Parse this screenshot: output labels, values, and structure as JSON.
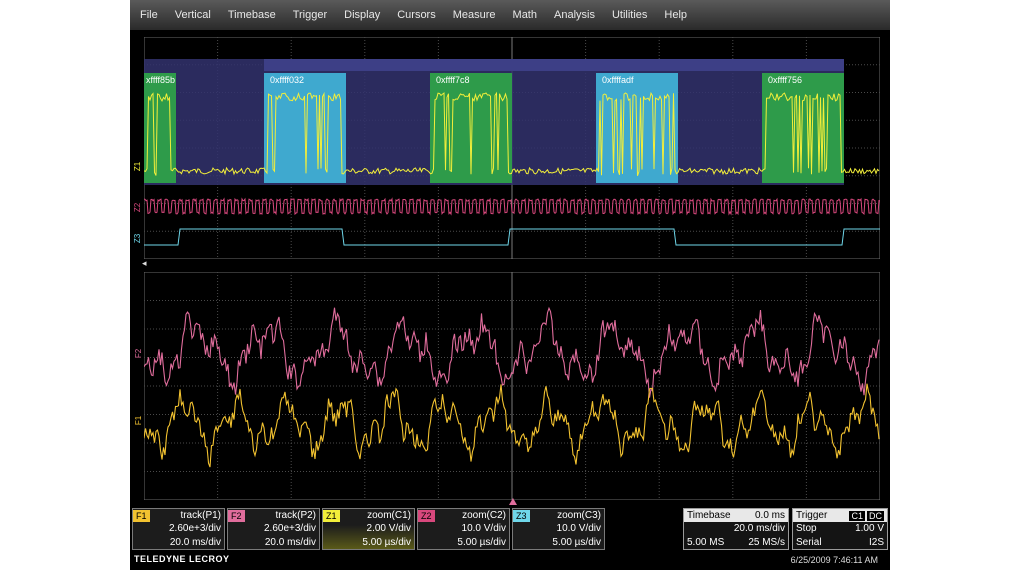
{
  "menu": [
    "File",
    "Vertical",
    "Timebase",
    "Trigger",
    "Display",
    "Cursors",
    "Measure",
    "Math",
    "Analysis",
    "Utilities",
    "Help"
  ],
  "decode_labels": [
    "xffff85b",
    "0xffff032",
    "0xffff7c8",
    "0xffffadf",
    "0xffff756"
  ],
  "trace_labels": {
    "z1": "Z1",
    "z2": "Z2",
    "z3": "Z3",
    "f1": "F1",
    "f2": "F2"
  },
  "colors": {
    "z1": "#f2ee3a",
    "z2": "#d8487d",
    "z3": "#6fd7ea",
    "f1": "#f2c230",
    "f2": "#e06d9c",
    "decode_blue": "#3fa9cf",
    "decode_green": "#2e9b4a",
    "decode_band": "#32336e"
  },
  "channels": [
    {
      "tag": "F1",
      "source": "track(P1)",
      "line1": "2.60e+3/div",
      "line2": "20.0 ms/div",
      "tag_color": "#f2c230"
    },
    {
      "tag": "F2",
      "source": "track(P2)",
      "line1": "2.60e+3/div",
      "line2": "20.0 ms/div",
      "tag_color": "#e06d9c"
    },
    {
      "tag": "Z1",
      "source": "zoom(C1)",
      "line1": "2.00 V/div",
      "line2": "5.00 µs/div",
      "tag_color": "#f2ee3a"
    },
    {
      "tag": "Z2",
      "source": "zoom(C2)",
      "line1": "10.0 V/div",
      "line2": "5.00 µs/div",
      "tag_color": "#d8487d"
    },
    {
      "tag": "Z3",
      "source": "zoom(C3)",
      "line1": "10.0 V/div",
      "line2": "5.00 µs/div",
      "tag_color": "#6fd7ea"
    }
  ],
  "timebase": {
    "label": "Timebase",
    "delay": "0.0 ms",
    "per_div": "20.0 ms/div",
    "samples": "5.00 MS",
    "rate": "25 MS/s"
  },
  "trigger": {
    "label": "Trigger",
    "source": "C1",
    "coupling": "DC",
    "mode": "Stop",
    "level": "1.00 V",
    "type": "Serial",
    "protocol": "I2S"
  },
  "brand": "TELEDYNE LECROY",
  "datetime": "6/25/2009 7:46:11 AM"
}
